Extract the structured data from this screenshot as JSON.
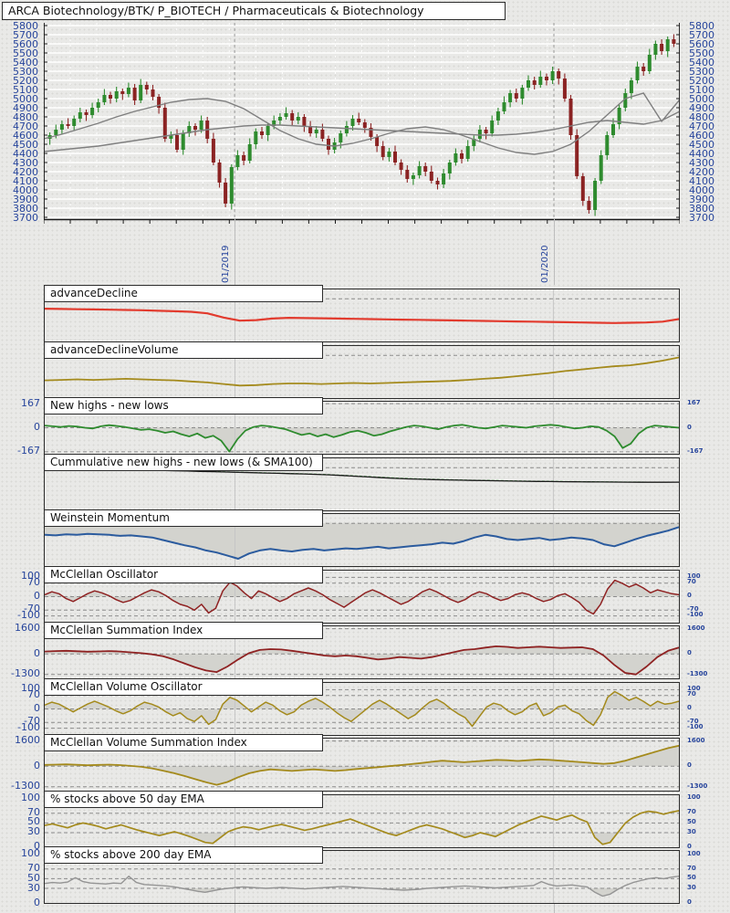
{
  "header": {
    "title": "ARCA Biotechnology/BTK/ P_BIOTECH / Pharmaceuticals & Biotechnology"
  },
  "colors": {
    "candle_up": "#2e8b2e",
    "candle_down": "#8b2323",
    "ma": "#7f7f7f",
    "axis_label_blue": "#27459c",
    "red": "#e23b2e",
    "olive": "#a48a1c",
    "green": "#2e8b2e",
    "green_dashed": "#3a9a3a",
    "blue": "#2b5b9e",
    "dark_red": "#8f2222",
    "gray": "#949494",
    "black": "#1a1a1a",
    "fill_gray": "#d3d3ce",
    "grid_dash": "#8c8c8c",
    "vgrid": "#c6c6c6",
    "white_grid": "#ffffff"
  },
  "chart_data": [
    {
      "type": "candlestick",
      "title": "ARCA Biotechnology/BTK/ P_BIOTECH / Pharmaceuticals & Biotechnology",
      "ylim": [
        3680,
        5830
      ],
      "ytick_start": 5800,
      "ytick_end": 3700,
      "ytick_step": 100,
      "x_gridlines": [
        {
          "label": "01/2019",
          "frac": 0.3
        },
        {
          "label": "01/2020",
          "frac": 0.802
        }
      ],
      "open0": 4560,
      "wick": [
        30,
        55,
        40,
        65,
        35,
        50
      ],
      "closes": [
        4600,
        4660,
        4720,
        4700,
        4780,
        4850,
        4820,
        4900,
        4960,
        5040,
        5000,
        5080,
        5050,
        5120,
        4980,
        5150,
        5100,
        5020,
        4900,
        4560,
        4600,
        4440,
        4620,
        4700,
        4660,
        4760,
        4560,
        4300,
        4080,
        3850,
        4250,
        4380,
        4320,
        4500,
        4640,
        4600,
        4700,
        4760,
        4800,
        4840,
        4760,
        4800,
        4700,
        4620,
        4660,
        4560,
        4440,
        4520,
        4620,
        4700,
        4780,
        4740,
        4680,
        4580,
        4480,
        4360,
        4420,
        4300,
        4220,
        4120,
        4160,
        4260,
        4200,
        4100,
        4060,
        4180,
        4300,
        4400,
        4340,
        4480,
        4560,
        4660,
        4620,
        4760,
        4860,
        4960,
        5060,
        5000,
        5120,
        5200,
        5150,
        5240,
        5200,
        5300,
        5220,
        5000,
        4600,
        4150,
        3880,
        3780,
        4100,
        4380,
        4600,
        4720,
        4900,
        5060,
        5200,
        5350,
        5300,
        5480,
        5600,
        5520,
        5650,
        5600
      ],
      "ma_fast": [
        4560,
        4610,
        4670,
        4730,
        4800,
        4860,
        4910,
        4960,
        4990,
        5000,
        4970,
        4890,
        4770,
        4650,
        4560,
        4500,
        4480,
        4510,
        4560,
        4620,
        4670,
        4690,
        4660,
        4600,
        4530,
        4460,
        4410,
        4390,
        4420,
        4500,
        4640,
        4820,
        5000,
        5060,
        4750,
        4990
      ],
      "ma_slow": [
        4420,
        4440,
        4460,
        4480,
        4510,
        4540,
        4570,
        4600,
        4630,
        4660,
        4680,
        4700,
        4710,
        4710,
        4700,
        4690,
        4680,
        4670,
        4660,
        4650,
        4640,
        4630,
        4620,
        4610,
        4600,
        4600,
        4610,
        4630,
        4660,
        4700,
        4740,
        4760,
        4740,
        4720,
        4760,
        4860
      ]
    },
    {
      "type": "line",
      "label": "advanceDecline",
      "color_key": "red",
      "lw": 2.2,
      "ylim": [
        0,
        100
      ],
      "grid": [
        82
      ],
      "fill": "none",
      "base": 0,
      "ticks": [],
      "values": [
        63,
        62.5,
        62,
        61.5,
        61,
        60.5,
        60,
        59,
        58,
        57,
        54,
        46,
        40,
        41,
        44,
        45.5,
        45,
        44.5,
        44,
        43.5,
        43,
        42.5,
        42,
        41.5,
        41,
        40.5,
        40,
        39.5,
        39,
        38.5,
        38,
        37.5,
        37,
        36.5,
        36,
        35.5,
        36,
        36.5,
        38,
        43
      ]
    },
    {
      "type": "line",
      "label": "advanceDeclineVolume",
      "color_key": "olive",
      "lw": 1.8,
      "ylim": [
        0,
        100
      ],
      "grid": [
        82
      ],
      "fill": "none",
      "base": 0,
      "ticks": [],
      "values": [
        34,
        35,
        36,
        35,
        36,
        37,
        36,
        35,
        34,
        32,
        30,
        27,
        24,
        25,
        27,
        28,
        28,
        27,
        28,
        29,
        28,
        29,
        30,
        31,
        32,
        33,
        35,
        37,
        39,
        42,
        45,
        48,
        52,
        55,
        58,
        61,
        63,
        67,
        72,
        78
      ]
    },
    {
      "type": "line",
      "label": "New highs - new lows",
      "color_key": "green",
      "lw": 1.8,
      "ylim": [
        -180,
        180
      ],
      "grid": [
        167,
        0,
        -167
      ],
      "fill": "below",
      "base": 0,
      "ticks": [
        {
          "v": 167,
          "t": "167"
        },
        {
          "v": 0,
          "t": "0"
        },
        {
          "v": -167,
          "t": "-167"
        }
      ],
      "values": [
        15,
        10,
        5,
        12,
        8,
        0,
        -5,
        10,
        18,
        12,
        5,
        -5,
        -15,
        -10,
        -20,
        -35,
        -25,
        -45,
        -60,
        -40,
        -70,
        -55,
        -90,
        -165,
        -80,
        -20,
        5,
        15,
        10,
        0,
        -10,
        -30,
        -50,
        -40,
        -60,
        -45,
        -65,
        -50,
        -30,
        -20,
        -35,
        -55,
        -45,
        -25,
        -10,
        5,
        15,
        10,
        0,
        -10,
        5,
        15,
        20,
        10,
        0,
        -5,
        5,
        15,
        10,
        5,
        0,
        10,
        15,
        20,
        15,
        5,
        -5,
        0,
        10,
        5,
        -20,
        -60,
        -140,
        -110,
        -40,
        0,
        15,
        10,
        5,
        0
      ]
    },
    {
      "type": "line",
      "label": "Cummulative new highs - new lows (& SMA100)",
      "color_key": "black",
      "lw": 1.3,
      "ylim": [
        0,
        100
      ],
      "grid": [
        82
      ],
      "fill": "none",
      "base": 0,
      "ticks": [],
      "values": [
        80,
        79.8,
        79.5,
        79.2,
        79,
        78.6,
        78.2,
        77.8,
        77.3,
        76.8,
        76.2,
        75.6,
        75,
        74.3,
        73.6,
        73,
        72.4,
        71.8,
        71.2,
        70.6,
        70,
        69.2,
        68.2,
        67,
        65.6,
        64.2,
        62.8,
        61.6,
        60.6,
        59.8,
        59.2,
        58.6,
        58.1,
        57.6,
        57.2,
        56.8,
        56.4,
        56,
        55.7,
        55.4,
        55.1,
        54.9,
        54.7,
        54.5,
        54.3,
        54.2,
        54.1,
        54,
        54,
        54.2
      ],
      "values2_color_key": "green_dashed",
      "values2": [
        80.5,
        80.3,
        80,
        79.7,
        79.4,
        79,
        78.6,
        78.2,
        77.7,
        77.2,
        76.6,
        76,
        75.4,
        74.7,
        74,
        73.4,
        72.8,
        72.2,
        71.6,
        71,
        70.4,
        69.6,
        68.7,
        67.6,
        66.4,
        65,
        63.6,
        62.4,
        61.4,
        60.5,
        59.8,
        59.2,
        58.6,
        58.1,
        57.7,
        57.3,
        56.9,
        56.5,
        56.2,
        55.9,
        55.6,
        55.4,
        55.2,
        55,
        54.8,
        54.6,
        54.5,
        54.4,
        54.3,
        54.3
      ]
    },
    {
      "type": "line",
      "label": "Weinstein Momentum",
      "color_key": "blue",
      "lw": 2,
      "ylim": [
        0,
        100
      ],
      "grid": [
        82
      ],
      "fill": "both",
      "base": 82,
      "ticks": [],
      "values": [
        60,
        59,
        61,
        60,
        62,
        61,
        60,
        58,
        59,
        57,
        55,
        50,
        45,
        40,
        36,
        30,
        26,
        20,
        14,
        24,
        30,
        33,
        30,
        28,
        31,
        33,
        30,
        32,
        34,
        33,
        35,
        37,
        34,
        36,
        38,
        40,
        42,
        45,
        43,
        48,
        55,
        60,
        57,
        52,
        50,
        52,
        54,
        50,
        52,
        55,
        53,
        50,
        42,
        38,
        45,
        52,
        58,
        63,
        68,
        75
      ]
    },
    {
      "type": "line",
      "label": "McClellan Oscillator",
      "color_key": "dark_red",
      "lw": 1.5,
      "ylim": [
        -135,
        135
      ],
      "grid": [
        100,
        70,
        0,
        -70,
        -100
      ],
      "fill": "both",
      "base": 0,
      "ticks": [
        {
          "v": 100,
          "t": "100"
        },
        {
          "v": 70,
          "t": "70"
        },
        {
          "v": 0,
          "t": "0"
        },
        {
          "v": -70,
          "t": "-70"
        },
        {
          "v": -100,
          "t": "-100"
        }
      ],
      "values": [
        10,
        25,
        15,
        -10,
        -25,
        -5,
        15,
        30,
        20,
        5,
        -15,
        -30,
        -20,
        0,
        20,
        35,
        25,
        5,
        -20,
        -40,
        -50,
        -70,
        -40,
        -85,
        -60,
        30,
        75,
        55,
        20,
        -10,
        30,
        15,
        -5,
        -25,
        -10,
        15,
        30,
        45,
        30,
        10,
        -15,
        -35,
        -55,
        -30,
        -5,
        20,
        35,
        20,
        0,
        -20,
        -40,
        -25,
        0,
        25,
        40,
        25,
        5,
        -15,
        -30,
        -15,
        10,
        25,
        15,
        -5,
        -20,
        -10,
        10,
        20,
        10,
        -10,
        -25,
        -15,
        5,
        15,
        -5,
        -30,
        -70,
        -90,
        -40,
        40,
        85,
        70,
        50,
        65,
        45,
        20,
        35,
        25,
        15,
        10
      ]
    },
    {
      "type": "line",
      "label": "McClellan Summation Index",
      "color_key": "dark_red",
      "lw": 1.8,
      "ylim": [
        -1550,
        1750
      ],
      "grid": [
        1600,
        0,
        -1300
      ],
      "fill": "both",
      "base": 0,
      "ticks": [
        {
          "v": 1600,
          "t": "1600"
        },
        {
          "v": 0,
          "t": "0"
        },
        {
          "v": -1300,
          "t": "-1300"
        }
      ],
      "values": [
        150,
        180,
        200,
        170,
        140,
        160,
        180,
        150,
        100,
        50,
        -30,
        -150,
        -350,
        -600,
        -850,
        -1050,
        -1150,
        -800,
        -350,
        50,
        250,
        300,
        280,
        200,
        100,
        0,
        -100,
        -150,
        -100,
        -150,
        -250,
        -350,
        -300,
        -200,
        -250,
        -300,
        -200,
        -50,
        100,
        250,
        300,
        400,
        480,
        450,
        380,
        420,
        460,
        420,
        380,
        400,
        420,
        300,
        -100,
        -700,
        -1200,
        -1300,
        -800,
        -200,
        200,
        400
      ]
    },
    {
      "type": "line",
      "label": "McClellan Volume Oscillator",
      "color_key": "olive",
      "lw": 1.5,
      "ylim": [
        -135,
        135
      ],
      "grid": [
        100,
        70,
        0,
        -70,
        -100
      ],
      "fill": "both",
      "base": 0,
      "ticks": [
        {
          "v": 100,
          "t": "100"
        },
        {
          "v": 70,
          "t": "70"
        },
        {
          "v": 0,
          "t": "0"
        },
        {
          "v": -70,
          "t": "-70"
        },
        {
          "v": -100,
          "t": "-100"
        }
      ],
      "values": [
        20,
        35,
        25,
        5,
        -15,
        5,
        25,
        40,
        25,
        10,
        -10,
        -25,
        -10,
        15,
        35,
        25,
        10,
        -15,
        -35,
        -20,
        -50,
        -65,
        -35,
        -80,
        -55,
        25,
        60,
        45,
        15,
        -15,
        10,
        35,
        20,
        -10,
        -30,
        -15,
        20,
        40,
        55,
        35,
        10,
        -20,
        -45,
        -65,
        -35,
        -5,
        25,
        45,
        25,
        0,
        -25,
        -50,
        -30,
        5,
        35,
        50,
        30,
        0,
        -25,
        -45,
        -90,
        -40,
        10,
        30,
        20,
        -10,
        -30,
        -15,
        15,
        30,
        -35,
        -20,
        10,
        20,
        -10,
        -25,
        -60,
        -85,
        -30,
        60,
        90,
        70,
        45,
        60,
        40,
        15,
        40,
        25,
        30,
        40
      ]
    },
    {
      "type": "line",
      "label": "McClellan Volume Summation Index",
      "color_key": "olive",
      "lw": 1.8,
      "ylim": [
        -1550,
        1750
      ],
      "grid": [
        1600,
        0,
        -1300
      ],
      "fill": "both",
      "base": 0,
      "ticks": [
        {
          "v": 1600,
          "t": "1600"
        },
        {
          "v": 0,
          "t": "0"
        },
        {
          "v": -1300,
          "t": "-1300"
        }
      ],
      "values": [
        80,
        100,
        120,
        90,
        60,
        80,
        100,
        70,
        20,
        -40,
        -140,
        -280,
        -440,
        -620,
        -820,
        -1020,
        -1180,
        -1000,
        -700,
        -450,
        -300,
        -200,
        -250,
        -300,
        -250,
        -200,
        -250,
        -300,
        -250,
        -180,
        -120,
        -60,
        0,
        60,
        130,
        200,
        280,
        350,
        300,
        250,
        300,
        350,
        400,
        380,
        330,
        380,
        430,
        400,
        350,
        300,
        250,
        200,
        150,
        200,
        350,
        550,
        750,
        950,
        1150,
        1300
      ]
    },
    {
      "type": "line",
      "label": "% stocks above 50 day EMA",
      "color_key": "olive",
      "lw": 1.7,
      "ylim": [
        0,
        107
      ],
      "grid": [
        70,
        50,
        30
      ],
      "fill": "below",
      "base": 30,
      "ticks": [
        {
          "v": 100,
          "t": "100"
        },
        {
          "v": 70,
          "t": "70"
        },
        {
          "v": 50,
          "t": "50"
        },
        {
          "v": 30,
          "t": "30"
        },
        {
          "v": 0,
          "t": "0"
        }
      ],
      "values": [
        45,
        48,
        44,
        40,
        46,
        50,
        47,
        43,
        38,
        42,
        46,
        41,
        36,
        32,
        28,
        24,
        28,
        32,
        27,
        22,
        16,
        10,
        8,
        20,
        32,
        38,
        42,
        40,
        36,
        40,
        44,
        47,
        43,
        39,
        35,
        38,
        42,
        46,
        50,
        54,
        58,
        52,
        46,
        40,
        34,
        28,
        24,
        30,
        36,
        42,
        46,
        42,
        38,
        32,
        26,
        20,
        24,
        30,
        26,
        22,
        30,
        38,
        46,
        52,
        58,
        64,
        60,
        56,
        62,
        66,
        58,
        52,
        20,
        6,
        10,
        30,
        50,
        62,
        70,
        74,
        72,
        68,
        72,
        75
      ]
    },
    {
      "type": "line",
      "label": "% stocks above 200 day EMA",
      "color_key": "gray",
      "lw": 1.4,
      "ylim": [
        0,
        107
      ],
      "grid": [
        70,
        50,
        30
      ],
      "fill": "below",
      "base": 30,
      "ticks": [
        {
          "v": 100,
          "t": "100"
        },
        {
          "v": 70,
          "t": "70"
        },
        {
          "v": 50,
          "t": "50"
        },
        {
          "v": 30,
          "t": "30"
        },
        {
          "v": 0,
          "t": "0"
        }
      ],
      "values": [
        40,
        42,
        41,
        43,
        52,
        44,
        41,
        40,
        39,
        41,
        40,
        55,
        42,
        38,
        37,
        36,
        35,
        33,
        30,
        27,
        24,
        22,
        25,
        28,
        30,
        32,
        33,
        32,
        31,
        30,
        31,
        32,
        31,
        30,
        29,
        30,
        31,
        32,
        33,
        34,
        33,
        32,
        31,
        30,
        29,
        28,
        27,
        26,
        27,
        28,
        30,
        31,
        32,
        33,
        34,
        35,
        34,
        33,
        32,
        31,
        32,
        33,
        34,
        35,
        36,
        44,
        38,
        35,
        36,
        37,
        35,
        33,
        22,
        14,
        18,
        28,
        36,
        42,
        46,
        50,
        52,
        50,
        53,
        55
      ]
    }
  ]
}
